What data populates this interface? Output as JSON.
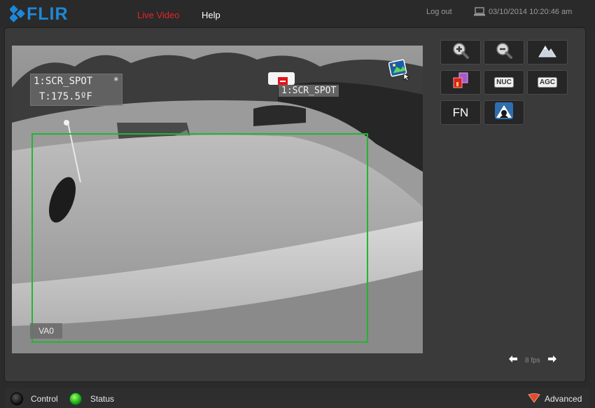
{
  "brand": {
    "name": "FLIR",
    "color": "#1e88d8"
  },
  "nav": {
    "items": [
      {
        "label": "Live Video",
        "active": true,
        "color": "#e4242a"
      },
      {
        "label": "Help",
        "active": false
      }
    ]
  },
  "header": {
    "logout_label": "Log out",
    "datetime": "03/10/2014 10:20:46 am",
    "laptop_icon": "laptop-icon"
  },
  "video": {
    "spot_overlay": {
      "name": "1:SCR_SPOT",
      "marker": "*",
      "temperature": "T:175.5ºF"
    },
    "spot_label": "1:SCR_SPOT",
    "analysis_area_label": "VA0",
    "analysis_area_color": "#23b532",
    "corner_icon": "image-snapshot-icon"
  },
  "tools": [
    {
      "name": "zoom-in-icon"
    },
    {
      "name": "zoom-out-icon"
    },
    {
      "name": "mountain-icon"
    },
    {
      "name": "palette-icon"
    },
    {
      "name": "nuc-icon",
      "label": "NUC"
    },
    {
      "name": "agc-icon",
      "label": "AGC"
    },
    {
      "name": "fn-icon",
      "label": "FN"
    },
    {
      "name": "scene-mode-icon"
    }
  ],
  "fps": {
    "value": "8 fps",
    "prev_icon": "arrow-left-icon",
    "next_icon": "arrow-right-icon"
  },
  "statusbar": {
    "control_label": "Control",
    "status_label": "Status",
    "advanced_label": "Advanced",
    "status_color": "#20a814",
    "advanced_icon": "chevron-down-icon"
  }
}
